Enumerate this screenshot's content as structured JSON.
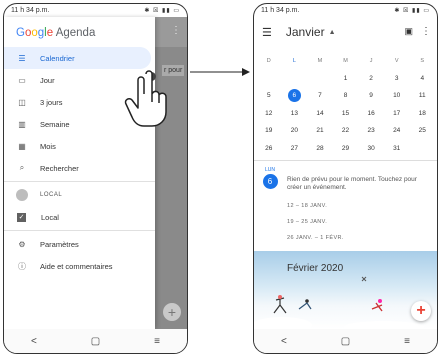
{
  "left_phone": {
    "status_time": "11 h 34 p.m.",
    "status_icons": "✱ ☒ ▮▮ ▭",
    "background_text": "r pour",
    "brand": {
      "g1": "G",
      "g2": "o",
      "g3": "o",
      "g4": "g",
      "g5": "l",
      "g6": "e",
      "app": "Agenda"
    },
    "nav": [
      {
        "label": "Calendrier",
        "icon": "calendar-list-icon"
      },
      {
        "label": "Jour",
        "icon": "day-view-icon"
      },
      {
        "label": "3 jours",
        "icon": "three-day-view-icon"
      },
      {
        "label": "Semaine",
        "icon": "week-view-icon"
      },
      {
        "label": "Mois",
        "icon": "month-view-icon"
      },
      {
        "label": "Rechercher",
        "icon": "search-icon"
      }
    ],
    "local_header": "LOCAL",
    "local_item": "Local",
    "settings": "Paramètres",
    "help": "Aide et commentaires",
    "navbar": {
      "back": "<",
      "home": "▢",
      "recents": "≡"
    }
  },
  "right_phone": {
    "status_time": "11 h 34 p.m.",
    "status_icons": "✱ ☒ ▮▮ ▭",
    "month": "Janvier",
    "weekdays": [
      "D",
      "L",
      "M",
      "M",
      "J",
      "V",
      "S"
    ],
    "weeks": [
      [
        "",
        "",
        "",
        "1",
        "2",
        "3",
        "4"
      ],
      [
        "5",
        "6",
        "7",
        "8",
        "9",
        "10",
        "11"
      ],
      [
        "12",
        "13",
        "14",
        "15",
        "16",
        "17",
        "18"
      ],
      [
        "19",
        "20",
        "21",
        "22",
        "23",
        "24",
        "25"
      ],
      [
        "26",
        "27",
        "28",
        "29",
        "30",
        "31",
        ""
      ]
    ],
    "selected_day": "6",
    "day_weekday": "LUN",
    "day_number": "6",
    "empty_text": "Rien de prévu pour le moment. Touchez pour créer un événement.",
    "week_ranges": [
      "12 – 18 JANV.",
      "19 – 25 JANV.",
      "26 JANV. – 1 FÉVR."
    ],
    "banner_title": "Février 2020",
    "navbar": {
      "back": "<",
      "home": "▢",
      "recents": "≡"
    }
  },
  "colors": {
    "accent": "#1a73e8",
    "active_bg": "#e8f0fe"
  }
}
